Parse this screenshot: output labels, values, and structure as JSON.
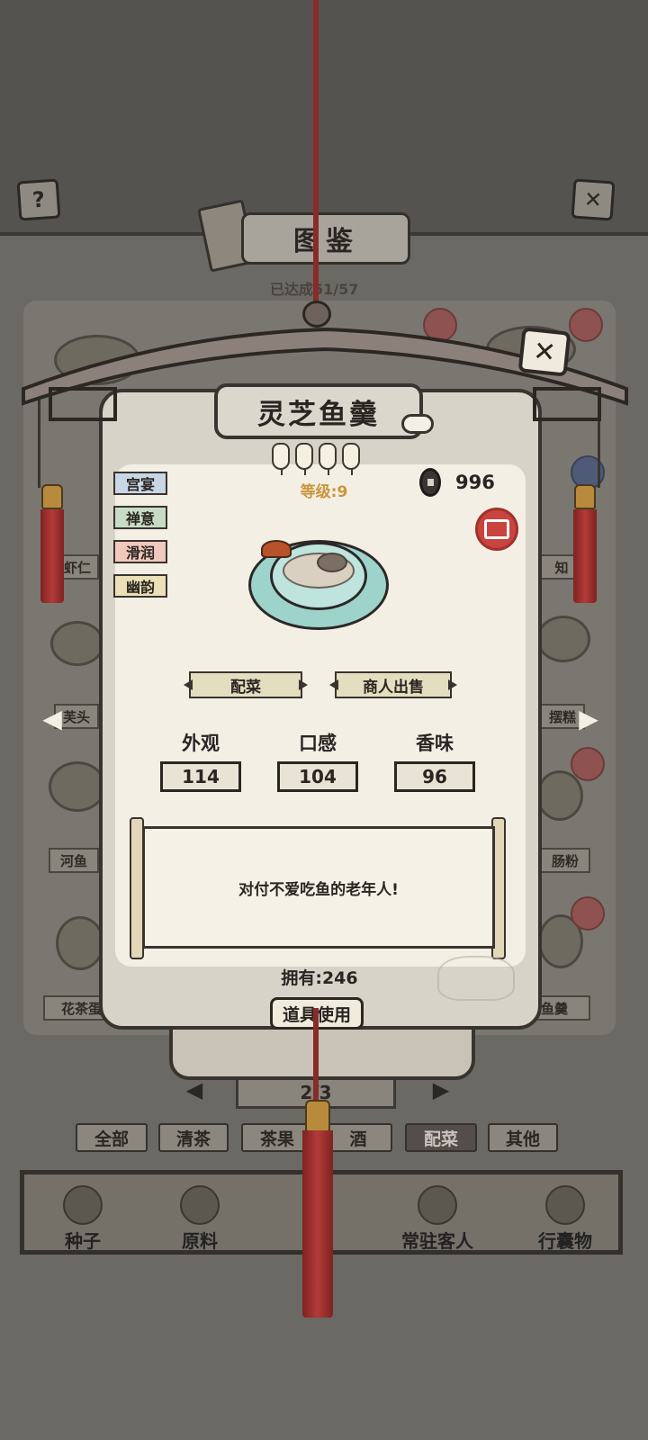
{
  "header": {
    "help_icon_glyph": "?",
    "close_icon_glyph": "✕",
    "title": "图鉴",
    "progress": "已达成51/57"
  },
  "background_grid": {
    "labels": [
      "虾仁",
      "知",
      "芙头",
      "摆糕",
      "河鱼",
      "肠粉",
      "花茶蛋羹",
      "灵芝鱼羹"
    ]
  },
  "modal": {
    "close_glyph": "✕",
    "dish_name": "灵芝鱼羹",
    "star_level": 4,
    "level_label": "等级:9",
    "price": "996",
    "tags": [
      {
        "label": "宫宴",
        "color": "#c8d6e6"
      },
      {
        "label": "禅意",
        "color": "#c7dcc4"
      },
      {
        "label": "滑润",
        "color": "#f0c8bc"
      },
      {
        "label": "幽韵",
        "color": "#ece0b8"
      }
    ],
    "actions": {
      "pair_label": "配菜",
      "sell_label": "商人出售"
    },
    "stats": [
      {
        "label": "外观",
        "value": "114"
      },
      {
        "label": "口感",
        "value": "104"
      },
      {
        "label": "香味",
        "value": "96"
      }
    ],
    "description": "对付不爱吃鱼的老年人!",
    "owned": "拥有:246",
    "use_label": "道具使用"
  },
  "pager": {
    "text": "2/3",
    "prev_glyph": "◀",
    "next_glyph": "▶"
  },
  "side_nav": {
    "prev_glyph": "◀",
    "next_glyph": "▶"
  },
  "tabs": [
    {
      "label": "全部",
      "active": false
    },
    {
      "label": "清茶",
      "active": false
    },
    {
      "label": "茶果",
      "active": false
    },
    {
      "label": "酒",
      "active": false
    },
    {
      "label": "配菜",
      "active": true
    },
    {
      "label": "其他",
      "active": false
    }
  ],
  "bottom_nav": [
    {
      "label": "种子"
    },
    {
      "label": "原料"
    },
    {
      "label": "常驻客人"
    },
    {
      "label": "行囊物"
    }
  ]
}
